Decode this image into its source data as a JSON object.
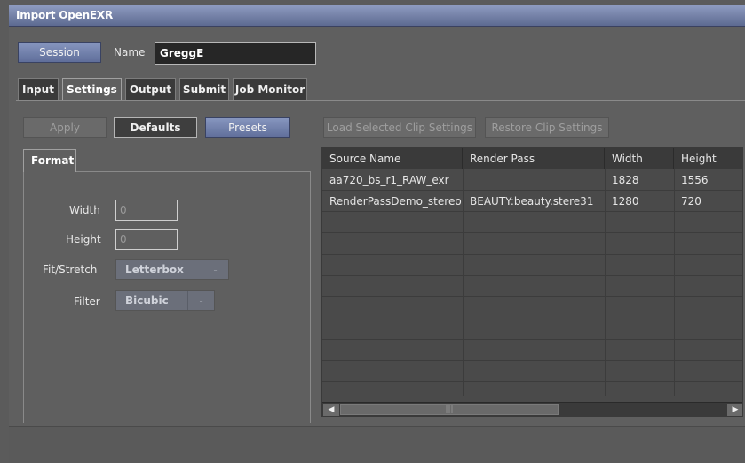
{
  "window": {
    "title": "Import OpenEXR"
  },
  "session": {
    "button_label": "Session",
    "name_label": "Name",
    "name_value": "GreggE"
  },
  "tabs": [
    {
      "label": "Input"
    },
    {
      "label": "Settings"
    },
    {
      "label": "Output"
    },
    {
      "label": "Submit"
    },
    {
      "label": "Job Monitor"
    }
  ],
  "active_tab": "Settings",
  "toolbar": {
    "apply": "Apply",
    "defaults": "Defaults",
    "presets": "Presets",
    "load_selected": "Load Selected Clip Settings",
    "restore": "Restore Clip Settings"
  },
  "format": {
    "tab_label": "Format",
    "width_label": "Width",
    "width_value": "0",
    "height_label": "Height",
    "height_value": "0",
    "fit_label": "Fit/Stretch",
    "fit_value": "Letterbox",
    "filter_label": "Filter",
    "filter_value": "Bicubic"
  },
  "clip_table": {
    "columns": [
      "Source Name",
      "Render Pass",
      "Width",
      "Height"
    ],
    "rows": [
      [
        "aa720_bs_r1_RAW_exr",
        "",
        "1828",
        "1556"
      ],
      [
        "RenderPassDemo_stereo",
        "BEAUTY:beauty.stere31",
        "1280",
        "720"
      ]
    ]
  },
  "colors": {
    "title_bar": "#6f7ca3",
    "blue_button": "#7483ad",
    "panel_bg": "#5f5f5f",
    "grid_bg": "#4a4a4a"
  }
}
